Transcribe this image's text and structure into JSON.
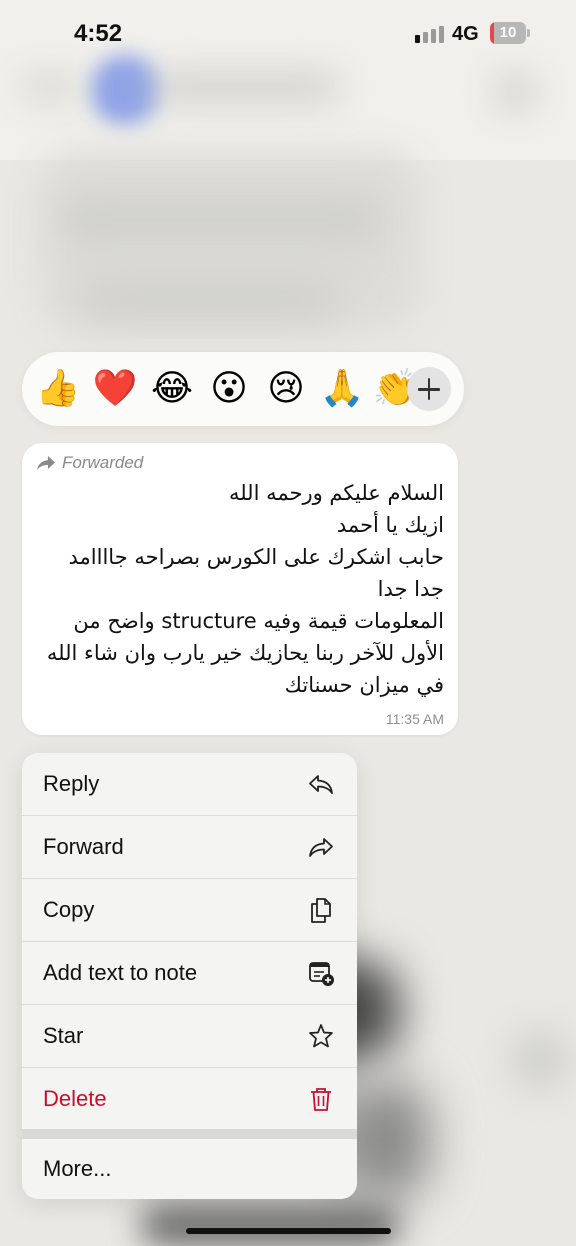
{
  "status_bar": {
    "time": "4:52",
    "network": "4G",
    "battery": "10",
    "battery_level": 0.1
  },
  "reactions": [
    {
      "icon": "thumbs-up",
      "glyph": "👍"
    },
    {
      "icon": "red-heart",
      "glyph": "❤️"
    },
    {
      "icon": "tears-of-joy",
      "glyph": "😂"
    },
    {
      "icon": "surprised-face",
      "glyph": "😮"
    },
    {
      "icon": "crying-face",
      "glyph": "😢"
    },
    {
      "icon": "folded-hands",
      "glyph": "🙏"
    },
    {
      "icon": "clapping-hands",
      "glyph": "👏"
    }
  ],
  "message": {
    "forwarded_label": "Forwarded",
    "lines": [
      "السلام عليكم ورحمه الله",
      "ازيك يا أحمد",
      "حابب اشكرك على الكورس بصراحه جاااامد جدا جدا",
      "المعلومات قيمة وفيه structure واضح من الأول للآخر ربنا يحازيك خير يارب وان شاء الله في ميزان حسناتك"
    ],
    "time": "11:35 AM"
  },
  "menu": {
    "items": [
      {
        "label": "Reply",
        "icon": "reply-icon"
      },
      {
        "label": "Forward",
        "icon": "forward-icon"
      },
      {
        "label": "Copy",
        "icon": "copy-icon"
      },
      {
        "label": "Add text to note",
        "icon": "add-note-icon"
      },
      {
        "label": "Star",
        "icon": "star-icon"
      },
      {
        "label": "Delete",
        "icon": "trash-icon"
      }
    ],
    "more": "More..."
  },
  "colors": {
    "delete": "#c8102e",
    "battery_low": "#e4484c"
  }
}
